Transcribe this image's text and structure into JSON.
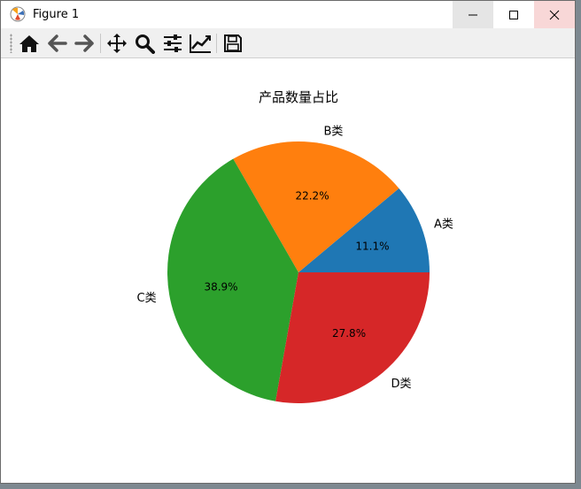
{
  "window": {
    "title": "Figure 1"
  },
  "toolbar": {
    "buttons": [
      {
        "name": "home-icon"
      },
      {
        "name": "back-arrow-icon"
      },
      {
        "name": "forward-arrow-icon"
      },
      {
        "name": "pan-icon"
      },
      {
        "name": "zoom-icon"
      },
      {
        "name": "configure-subplots-icon"
      },
      {
        "name": "edit-axis-icon"
      },
      {
        "name": "save-icon"
      }
    ]
  },
  "chart_data": {
    "type": "pie",
    "title": "产品数量占比",
    "categories": [
      "A类",
      "B类",
      "C类",
      "D类"
    ],
    "values": [
      11.1,
      22.2,
      38.9,
      27.8
    ],
    "autopct": [
      "11.1%",
      "22.2%",
      "38.9%",
      "27.8%"
    ],
    "colors": [
      "#1f77b4",
      "#ff7f0e",
      "#2ca02c",
      "#d62728"
    ],
    "start_angle_deg": 0,
    "direction": "counterclockwise"
  }
}
